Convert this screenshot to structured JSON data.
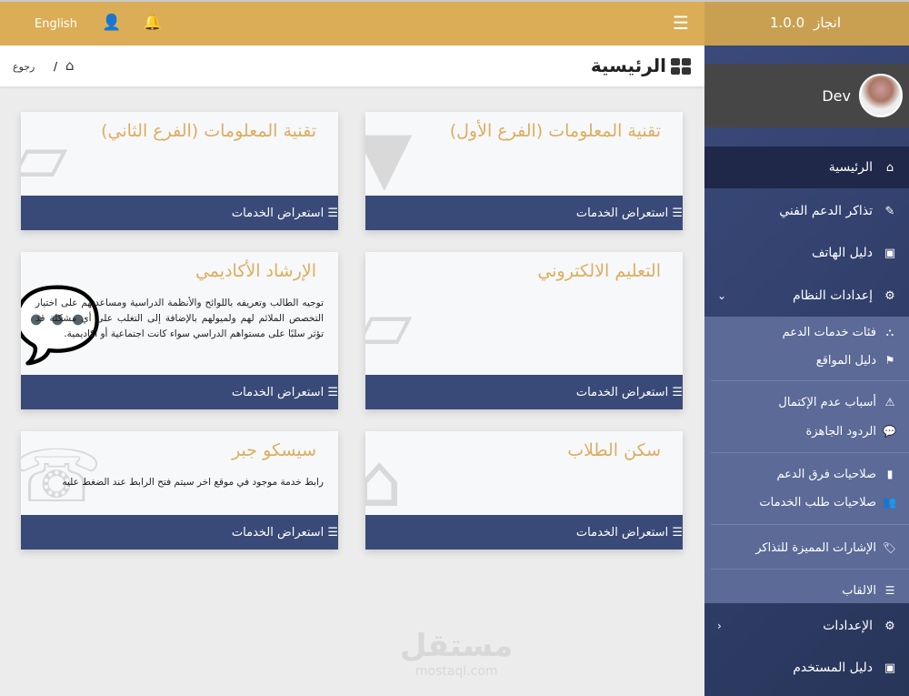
{
  "topbar": {
    "language": "English",
    "user_icon": "user-icon",
    "bell_icon": "bell-icon",
    "menu_icon": "menu-icon"
  },
  "breadcrumb": {
    "title": "الرئيسية",
    "back": "رجوع",
    "separator": "/"
  },
  "cards": [
    {
      "title": "تقنية المعلومات (الفرع الأول)",
      "description": "",
      "button": "استعراض الخدمات",
      "icon": "tie-icon"
    },
    {
      "title": "تقنية المعلومات (الفرع الثاني)",
      "description": "",
      "button": "استعراض الخدمات",
      "icon": "ticket-icon"
    },
    {
      "title": "التعليم الالكتروني",
      "description": "",
      "button": "استعراض الخدمات",
      "icon": "ticket-icon"
    },
    {
      "title": "الإرشاد الأكاديمي",
      "description": "توجيه الطالب وتعريفه باللوائح والأنظمة الدراسية ومساعدتهم على اختيار التخصص الملائم لهم ولميولهم بالإضافة إلى التغلب على أي مشكلة قد تؤثر سلبًا على مستواهم الدراسي سواء كانت اجتماعية أو أكاديمية.",
      "button": "استعراض الخدمات",
      "icon": "comments-icon"
    },
    {
      "title": "سكن الطلاب",
      "description": "",
      "button": "استعراض الخدمات",
      "icon": "house-icon"
    },
    {
      "title": "سيسكو جبر",
      "description": "رابط خدمة موجود في موقع اخر سيتم فتح الرابط عند الضغط عليه",
      "button": "استعراض الخدمات",
      "icon": "phone-icon"
    }
  ],
  "sidebar": {
    "brand": "انجاز",
    "version": "1.0.0",
    "user": "Dev",
    "items": [
      {
        "label": "الرئيسية",
        "icon": "⌂"
      },
      {
        "label": "تذاكر الدعم الفني",
        "icon": "✎"
      },
      {
        "label": "دليل الهاتف",
        "icon": "▣"
      },
      {
        "label": "إعدادات النظام",
        "icon": "⚙",
        "chevron": "⌄"
      },
      {
        "label": "الإعدادات",
        "icon": "⚙",
        "chevron": "‹"
      },
      {
        "label": "دليل المستخدم",
        "icon": "▣"
      }
    ],
    "subitems": [
      {
        "label": "فئات خدمات الدعم",
        "icon": "⛬"
      },
      {
        "label": "دليل المواقع",
        "icon": "⚑"
      },
      {
        "label": "أسباب عدم الإكتمال",
        "icon": "⚠"
      },
      {
        "label": "الردود الجاهزة",
        "icon": "💬"
      },
      {
        "label": "صلاحيات فرق الدعم",
        "icon": "▮"
      },
      {
        "label": "صلاحيات طلب الخدمات",
        "icon": "👥"
      },
      {
        "label": "الإشارات المميزة للتذاكر",
        "icon": "🏷"
      },
      {
        "label": "الالقاب",
        "icon": "☰"
      }
    ]
  },
  "watermark": {
    "ar": "مستقل",
    "en": "mostaql.com"
  }
}
